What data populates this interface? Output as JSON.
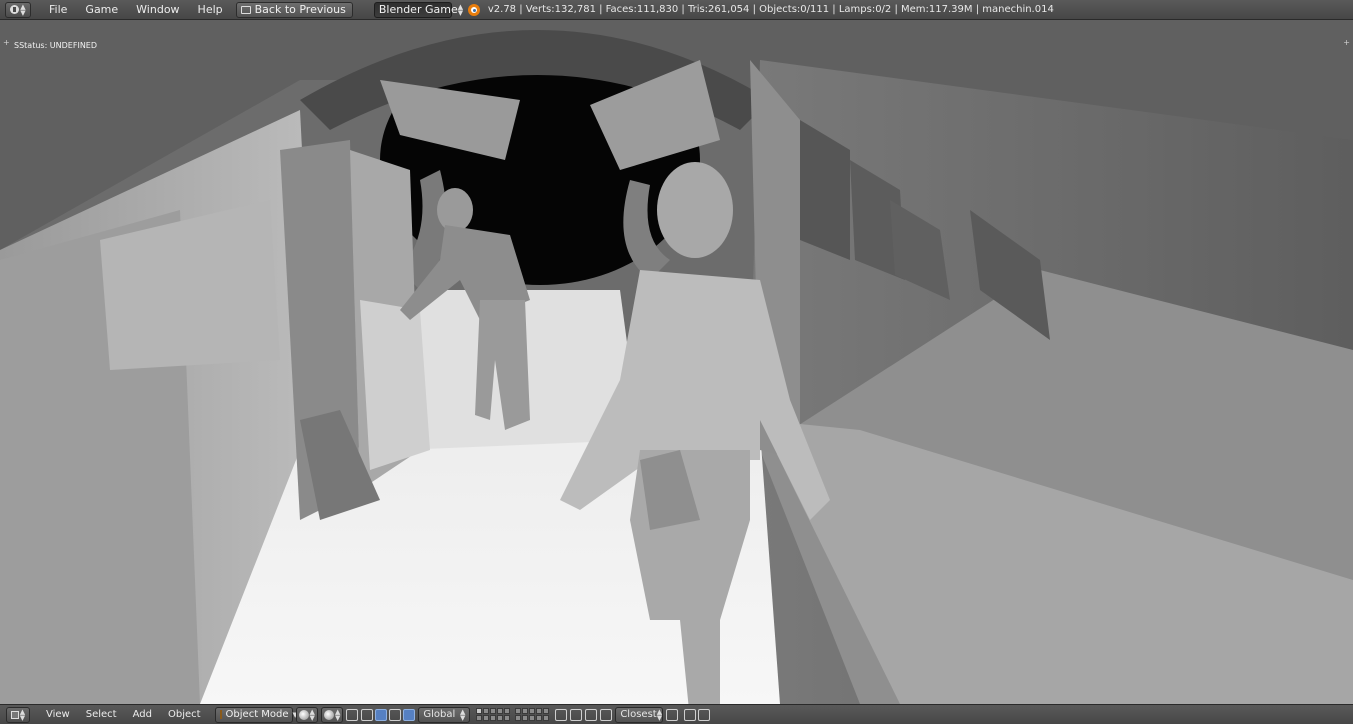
{
  "topbar": {
    "editor_icon": "info-icon",
    "menus": [
      "File",
      "Game",
      "Window",
      "Help"
    ],
    "back_button": "Back to Previous",
    "engine": "Blender Game",
    "stats": "v2.78 | Verts:132,781 | Faces:111,830 | Tris:261,054 | Objects:0/111 | Lamps:0/2 | Mem:117.39M | manechin.014"
  },
  "viewport": {
    "overlay_text": "SStatus: UNDEFINED",
    "corner_left": "+",
    "corner_right": "+"
  },
  "bottombar": {
    "editor_icon": "3d-view-icon",
    "menus": [
      "View",
      "Select",
      "Add",
      "Object"
    ],
    "mode": "Object Mode",
    "orientation": "Global",
    "snap_target": "Closest"
  },
  "colors": {
    "header_bg": "#474747",
    "accent_blue": "#5680c2",
    "blender_orange": "#e87d0d"
  }
}
